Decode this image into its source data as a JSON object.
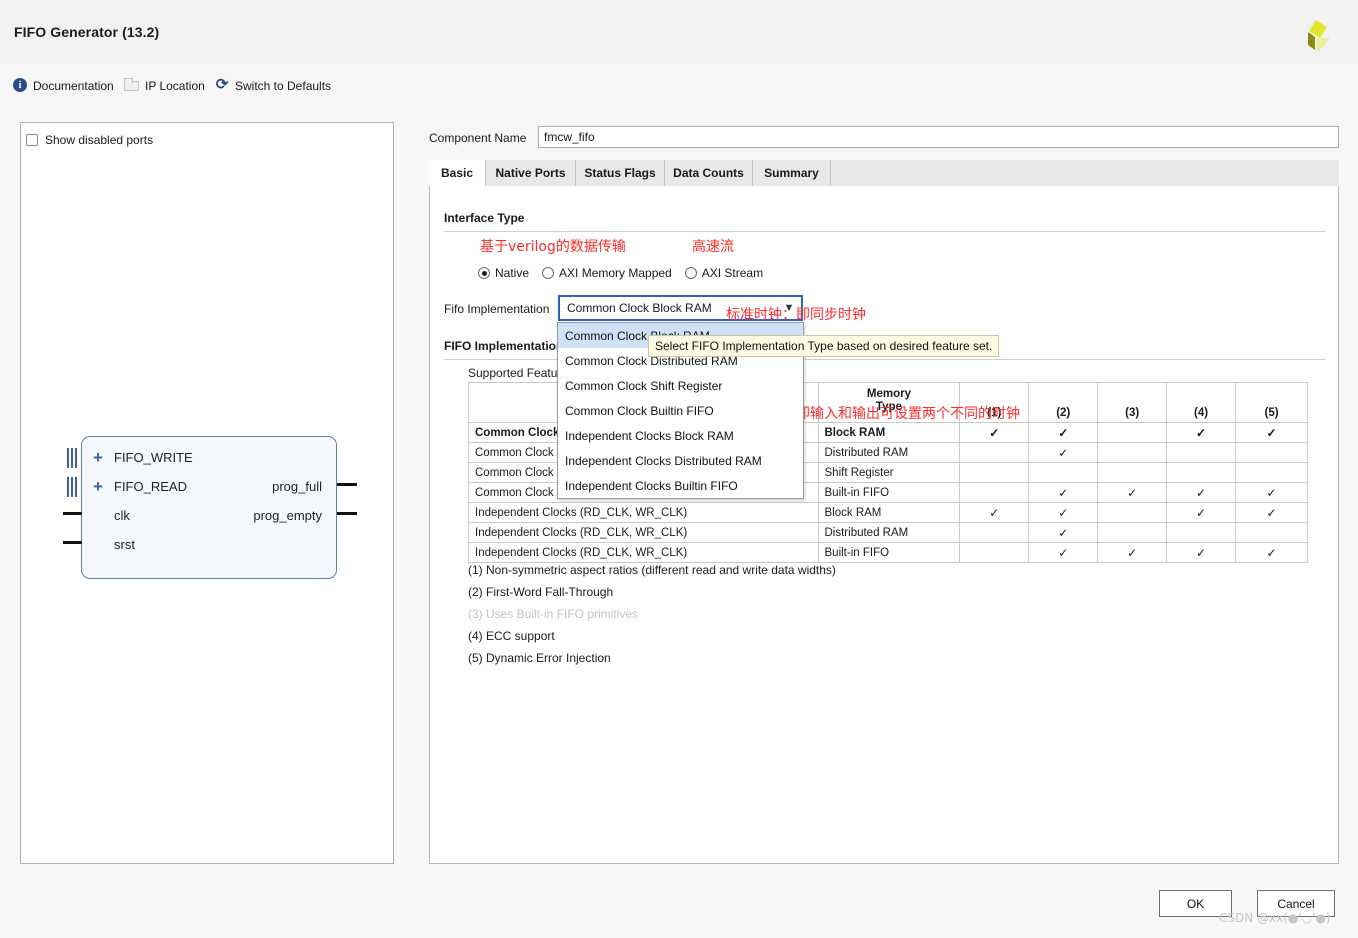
{
  "window": {
    "title": "FIFO Generator (13.2)",
    "logo": "xilinx-logo"
  },
  "linkbar": [
    {
      "label": "Documentation",
      "icon": "info-icon"
    },
    {
      "label": "IP Location",
      "icon": "folder-icon"
    },
    {
      "label": "Switch to Defaults",
      "icon": "refresh-icon"
    }
  ],
  "left_panel": {
    "show_disabled_ports": "Show disabled ports",
    "symbol": {
      "inputs_bus": [
        "FIFO_WRITE",
        "FIFO_READ"
      ],
      "inputs_pin": [
        "clk",
        "srst"
      ],
      "outputs_pin": [
        "prog_full",
        "prog_empty"
      ]
    }
  },
  "component": {
    "name_label": "Component Name",
    "name_value": "fmcw_fifo"
  },
  "tabs": [
    {
      "label": "Basic",
      "active": true
    },
    {
      "label": "Native Ports",
      "active": false
    },
    {
      "label": "Status Flags",
      "active": false
    },
    {
      "label": "Data Counts",
      "active": false
    },
    {
      "label": "Summary",
      "active": false
    }
  ],
  "interface_type": {
    "section_title": "Interface Type",
    "options": [
      {
        "label": "Native",
        "selected": true
      },
      {
        "label": "AXI Memory Mapped",
        "selected": false
      },
      {
        "label": "AXI Stream",
        "selected": false
      }
    ],
    "annotation_native": "基于verilog的数据传输",
    "annotation_axis": "高速流"
  },
  "fifo_implementation": {
    "combo_label": "Fifo Implementation",
    "combo_value": "Common Clock Block RAM",
    "arrow_icon": "chevron-down-icon",
    "options": [
      "Common Clock Block RAM",
      "Common Clock Distributed RAM",
      "Common Clock Shift Register",
      "Common Clock Builtin FIFO",
      "Independent Clocks Block RAM",
      "Independent Clocks Distributed RAM",
      "Independent Clocks Builtin FIFO"
    ],
    "highlighted_option": "Common Clock Block RAM",
    "tooltip": "Select FIFO Implementation Type based on desired feature set.",
    "annotation_common": "标准时钟：即同步时钟",
    "annotation_independent": "独立时钟：即输入和输出可设置两个不同的时钟"
  },
  "feature_section": {
    "section_title": "FIFO Implementation",
    "table_label": "Supported Features",
    "columns": [
      "",
      "Memory\nType",
      "(1)",
      "(2)",
      "(3)",
      "(4)",
      "(5)"
    ],
    "col_memory_type": "Memory Type",
    "col_nums": [
      "(1)",
      "(2)",
      "(3)",
      "(4)",
      "(5)"
    ],
    "rows": [
      {
        "clocking": "Common Clock (CLK)",
        "memory": "Block RAM",
        "selected": true,
        "checks": [
          true,
          true,
          false,
          true,
          true
        ]
      },
      {
        "clocking": "Common Clock (CLK)",
        "memory": "Distributed RAM",
        "selected": false,
        "checks": [
          false,
          true,
          false,
          false,
          false
        ]
      },
      {
        "clocking": "Common Clock (CLK)",
        "memory": "Shift Register",
        "selected": false,
        "checks": [
          false,
          false,
          false,
          false,
          false
        ]
      },
      {
        "clocking": "Common Clock (CLK)",
        "memory": "Built-in FIFO",
        "selected": false,
        "checks": [
          false,
          true,
          true,
          true,
          true
        ]
      },
      {
        "clocking": "Independent Clocks (RD_CLK, WR_CLK)",
        "memory": "Block RAM",
        "selected": false,
        "checks": [
          true,
          true,
          false,
          true,
          true
        ]
      },
      {
        "clocking": "Independent Clocks (RD_CLK, WR_CLK)",
        "memory": "Distributed RAM",
        "selected": false,
        "checks": [
          false,
          true,
          false,
          false,
          false
        ]
      },
      {
        "clocking": "Independent Clocks (RD_CLK, WR_CLK)",
        "memory": "Built-in FIFO",
        "selected": false,
        "checks": [
          false,
          true,
          true,
          true,
          true
        ]
      }
    ],
    "footnotes": [
      {
        "text": "(1) Non-symmetric aspect ratios (different read and write data widths)",
        "dim": false
      },
      {
        "text": "(2) First-Word Fall-Through",
        "dim": false
      },
      {
        "text": "(3) Uses Built-in FIFO primitives",
        "dim": true
      },
      {
        "text": "(4) ECC support",
        "dim": false
      },
      {
        "text": "(5) Dynamic Error Injection",
        "dim": false
      }
    ]
  },
  "footer": {
    "ok": "OK",
    "cancel": "Cancel",
    "watermark": "CSDN @xx(●'◡'●)"
  },
  "colors": {
    "accent_blue": "#2a63c4",
    "annotation_red": "#ff2b2b",
    "highlight": "#cfe1f7",
    "tooltip_bg": "#fdfbe4"
  }
}
